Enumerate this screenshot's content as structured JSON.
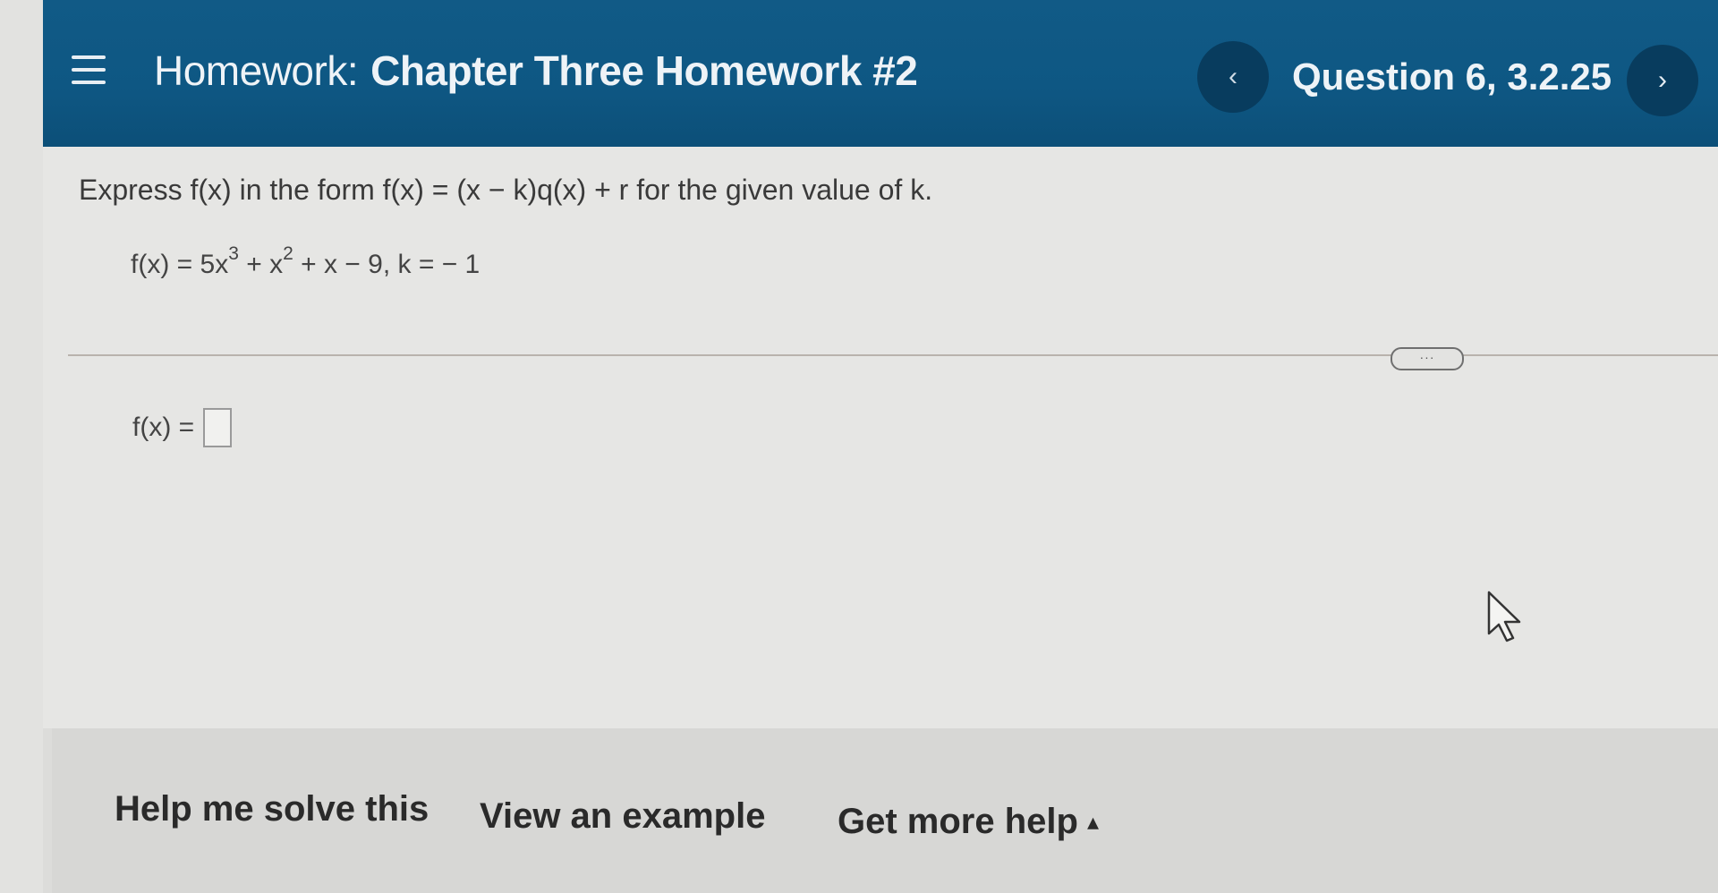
{
  "header": {
    "prefix": "Homework:",
    "title": "Chapter Three Homework #2",
    "question": "Question 6, 3.2.25",
    "prev_icon": "‹",
    "next_icon": "›"
  },
  "problem": {
    "instructions": "Express f(x) in the form f(x) = (x − k)q(x) + r for the given value of k.",
    "func_lhs": "f(x) = 5x",
    "exp1": "3",
    "term2": " + x",
    "exp2": "2",
    "rest": " + x − 9, k = − 1"
  },
  "divider": {
    "more_label": "···"
  },
  "answer": {
    "label": "f(x) =",
    "value": ""
  },
  "help": {
    "solve": "Help me solve this",
    "example": "View an example",
    "more": "Get more help",
    "more_caret": "▴"
  },
  "icons": {
    "menu": "menu-icon",
    "prev": "chevron-left-icon",
    "next": "chevron-right-icon",
    "cursor": "mouse-pointer-icon"
  },
  "colors": {
    "header_bg": "#0e5783",
    "nav_button_bg": "#083c5e",
    "page_bg": "#e6e6e4",
    "help_bar_bg": "#d7d7d5"
  }
}
